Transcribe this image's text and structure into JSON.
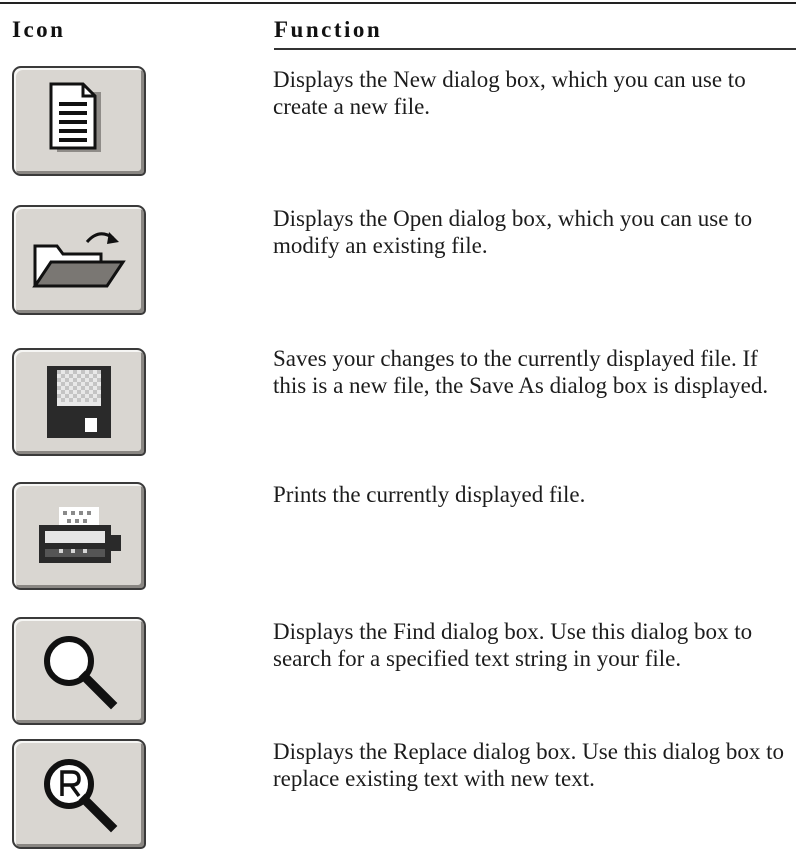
{
  "header": {
    "icon_label": "Icon",
    "function_label": "Function"
  },
  "rows": [
    {
      "icon": "new-file-icon",
      "description": "Displays the New dialog box, which you can use to create a new file."
    },
    {
      "icon": "open-folder-icon",
      "description": "Displays the Open dialog box, which you can use to modify an existing file."
    },
    {
      "icon": "save-disk-icon",
      "description": "Saves your changes to the currently displayed file.  If this is a new file, the Save As dialog box is displayed."
    },
    {
      "icon": "printer-icon",
      "description": "Prints the currently displayed file."
    },
    {
      "icon": "find-magnifier-icon",
      "description": "Displays the Find dialog box.  Use this dialog box to search for a specified text string in your file."
    },
    {
      "icon": "replace-magnifier-icon",
      "description": "Displays the Replace dialog box.  Use this dialog box to replace existing text with new text."
    }
  ]
}
